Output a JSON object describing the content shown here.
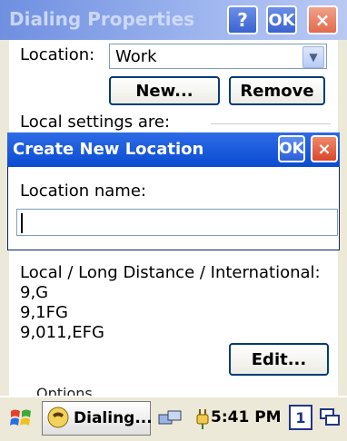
{
  "background_dialog": {
    "title": "Dialing Properties",
    "help_label": "?",
    "ok_label": "OK",
    "close_label": "×",
    "location_label": "Location:",
    "location_value": "Work",
    "new_button": "New...",
    "remove_button": "Remove",
    "local_settings_label": "Local settings are:",
    "codes_header": "Local / Long Distance / International:",
    "codes": [
      "9,G",
      "9,1FG",
      "9,011,EFG"
    ],
    "edit_button": "Edit...",
    "options_peek": "Options"
  },
  "foreground_dialog": {
    "title": "Create New Location",
    "ok_label": "OK",
    "close_label": "×",
    "location_name_label": "Location name:",
    "location_name_value": ""
  },
  "taskbar": {
    "task_label": "Dialing...",
    "clock": "5:41 PM",
    "keyboard_badge": "1"
  },
  "icons": {
    "start": "windows-flag-icon",
    "task": "dialing-icon",
    "network": "network-icon",
    "power": "power-plug-icon",
    "desktop": "windows-switch-icon"
  }
}
